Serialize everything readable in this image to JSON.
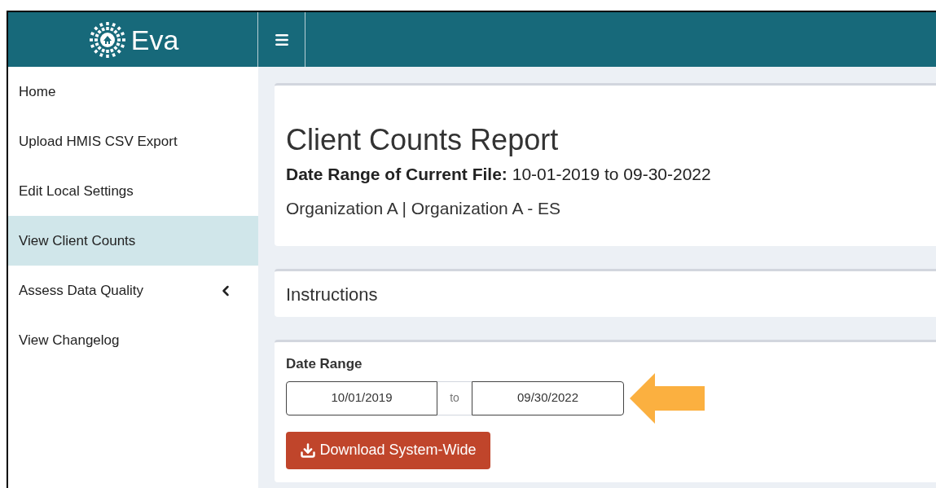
{
  "brand": {
    "name": "Eva"
  },
  "sidebar": {
    "items": [
      {
        "label": "Home",
        "selected": false,
        "has_submenu": false
      },
      {
        "label": "Upload HMIS CSV Export",
        "selected": false,
        "has_submenu": false
      },
      {
        "label": "Edit Local Settings",
        "selected": false,
        "has_submenu": false
      },
      {
        "label": "View Client Counts",
        "selected": true,
        "has_submenu": false
      },
      {
        "label": "Assess Data Quality",
        "selected": false,
        "has_submenu": true
      },
      {
        "label": "View Changelog",
        "selected": false,
        "has_submenu": false
      }
    ]
  },
  "report": {
    "title": "Client Counts Report",
    "date_range": "**Date Range of Current File:** 10-01-2019 to 09-30-2022",
    "organization": "Organization A | Organization A - ES"
  },
  "instructions": {
    "title": "Instructions"
  },
  "date_range": {
    "label": "Date Range",
    "start": "10/01/2019",
    "separator": "to",
    "end": "09/30/2022",
    "download_button": "Download System-Wide"
  }
}
